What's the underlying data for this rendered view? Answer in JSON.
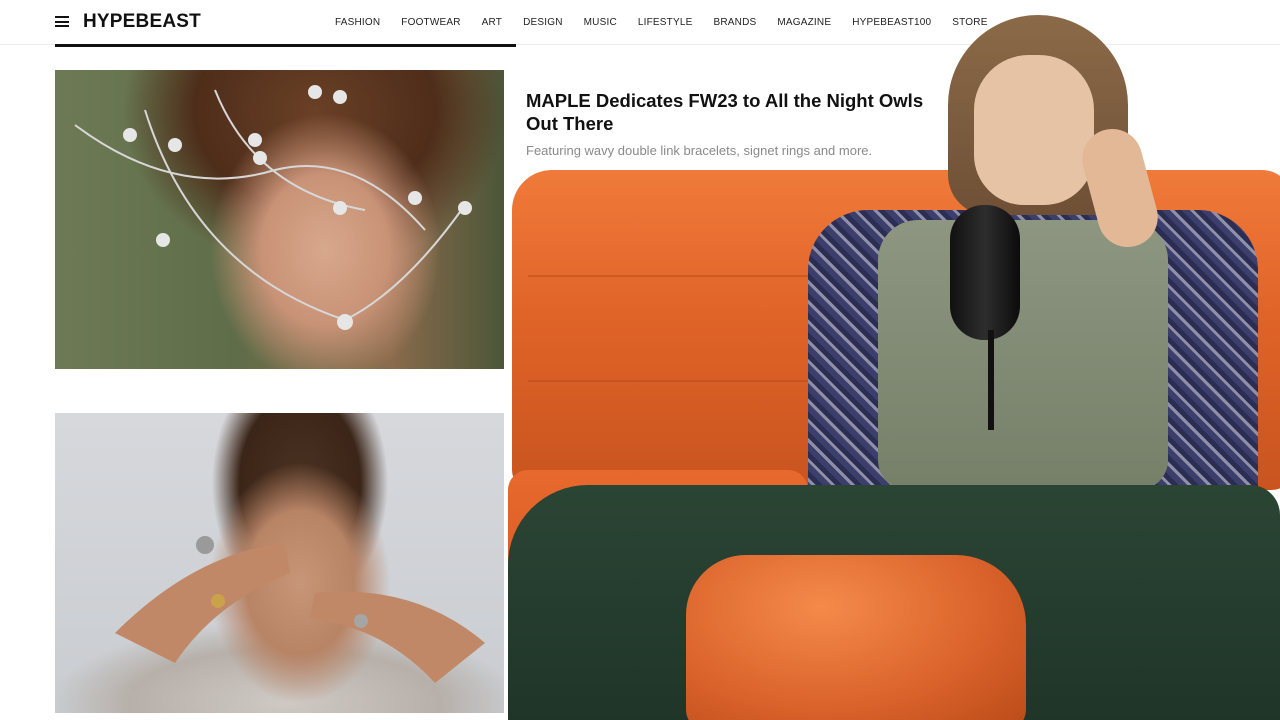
{
  "header": {
    "logo": "HYPEBEAST",
    "nav": [
      "FASHION",
      "FOOTWEAR",
      "ART",
      "DESIGN",
      "MUSIC",
      "LIFESTYLE",
      "BRANDS",
      "MAGAZINE",
      "HYPEBEAST100",
      "STORE"
    ]
  },
  "article": {
    "title": "MAPLE Dedicates FW23 to All the Night Owls Out There",
    "subtitle": "Featuring wavy double link bracelets, signet rings and more."
  },
  "colors": {
    "accent": "#111111",
    "sofa": "#e06428",
    "subtitle_text": "#8a8a8a"
  }
}
